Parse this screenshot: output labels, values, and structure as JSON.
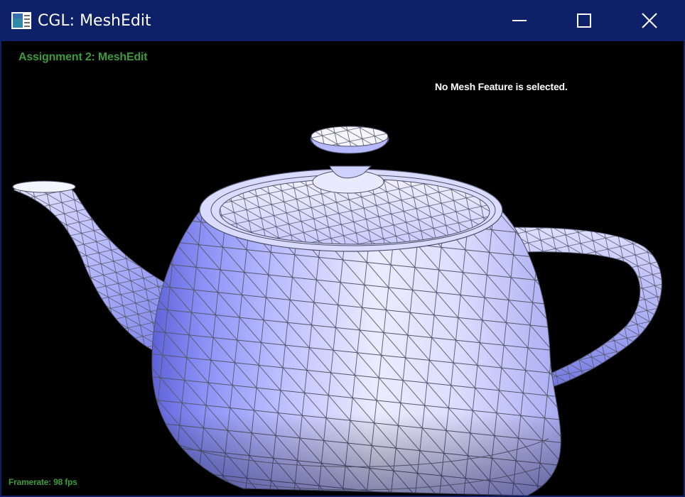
{
  "window": {
    "title": "CGL: MeshEdit",
    "controls": {
      "minimize": "minimize-icon",
      "maximize": "maximize-icon",
      "close": "close-icon"
    }
  },
  "viewport": {
    "assignment_label": "Assignment 2: MeshEdit",
    "selection_status": "No Mesh Feature is selected.",
    "framerate": "Framerate: 98 fps",
    "model": "teapot",
    "colors": {
      "background": "#000000",
      "mesh_fill": "#c8cbff",
      "mesh_shade": "#7d82f0",
      "wireframe": "#6b6b7a",
      "hud_text": "#3e9b3b",
      "status_text": "#ffffff",
      "titlebar": "#0e2168"
    }
  }
}
